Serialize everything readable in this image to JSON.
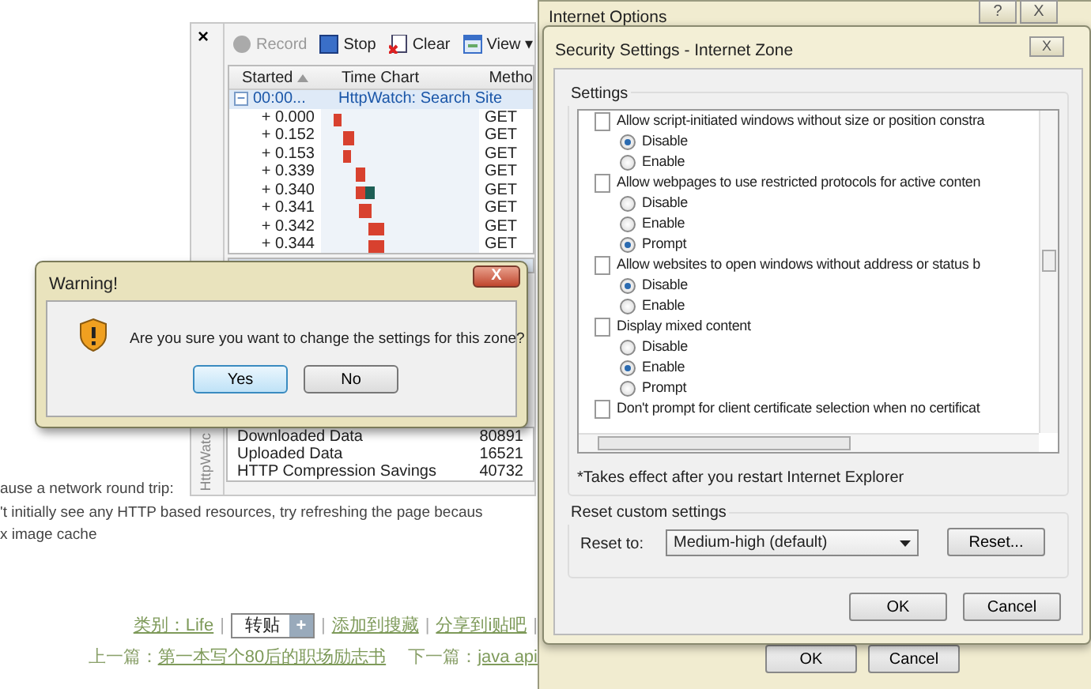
{
  "httpwatch": {
    "close": "×",
    "toolbar": [
      {
        "label": "Record",
        "disabled": true
      },
      {
        "label": "Stop",
        "disabled": false
      },
      {
        "label": "Clear",
        "disabled": false
      },
      {
        "label": "View",
        "disabled": false,
        "caret": "▾"
      }
    ],
    "columns": [
      {
        "label": "Started",
        "sorted": true
      },
      {
        "label": "Time Chart",
        "sorted": false
      },
      {
        "label": "Metho",
        "sorted": false
      }
    ],
    "group": {
      "toggle": "−",
      "started": "00:00...",
      "title": "HttpWatch: Search Site"
    },
    "requests": [
      {
        "started": "+ 0.000",
        "method": "GET"
      },
      {
        "started": "+ 0.152",
        "method": "GET"
      },
      {
        "started": "+ 0.153",
        "method": "GET"
      },
      {
        "started": "+ 0.339",
        "method": "GET"
      },
      {
        "started": "+ 0.340",
        "method": "GET"
      },
      {
        "started": "+ 0.341",
        "method": "GET"
      },
      {
        "started": "+ 0.342",
        "method": "GET"
      },
      {
        "started": "+ 0.344",
        "method": "GET"
      }
    ],
    "tab_label": "HttpWatc",
    "summary": [
      {
        "label": "Downloaded Data",
        "value": "80891"
      },
      {
        "label": "Uploaded Data",
        "value": "16521"
      },
      {
        "label": "HTTP Compression Savings",
        "value": "40732"
      }
    ]
  },
  "page": {
    "lines": [
      "ause a network round trip:",
      "'t initially see any HTTP based resources, try refreshing the page becaus",
      "x image cache"
    ],
    "footer_row": [
      {
        "kind": "link",
        "text": "类别：Life"
      },
      {
        "kind": "sep",
        "text": "|"
      },
      {
        "kind": "repost",
        "text": "转贴",
        "plus": "+"
      },
      {
        "kind": "sep",
        "text": "|"
      },
      {
        "kind": "link",
        "text": "添加到搜藏"
      },
      {
        "kind": "sep",
        "text": "|"
      },
      {
        "kind": "link",
        "text": "分享到i贴吧"
      },
      {
        "kind": "sep",
        "text": "|"
      }
    ],
    "nav": [
      {
        "label": "上一篇：",
        "link": "第一本写个80后的职场励志书"
      },
      {
        "label": "下一篇：",
        "link": "java api"
      }
    ]
  },
  "warning": {
    "title": "Warning!",
    "close": "X",
    "message": "Are you sure you want to change the settings for this zone?",
    "buttons": [
      {
        "label": "Yes",
        "focused": true
      },
      {
        "label": "No",
        "focused": false
      }
    ]
  },
  "internet_options": {
    "title": "Internet Options",
    "help": "?",
    "close": "X",
    "buttons": [
      "OK",
      "Cancel"
    ]
  },
  "security": {
    "title": "Security Settings - Internet Zone",
    "close": "X",
    "group_label": "Settings",
    "items": [
      {
        "kind": "heading",
        "text": "Allow script-initiated windows without size or position constra"
      },
      {
        "kind": "radio",
        "text": "Disable",
        "selected": true
      },
      {
        "kind": "radio",
        "text": "Enable",
        "selected": false
      },
      {
        "kind": "heading",
        "text": "Allow webpages to use restricted protocols for active conten"
      },
      {
        "kind": "radio",
        "text": "Disable",
        "selected": false
      },
      {
        "kind": "radio",
        "text": "Enable",
        "selected": false
      },
      {
        "kind": "radio",
        "text": "Prompt",
        "selected": true
      },
      {
        "kind": "heading",
        "text": "Allow websites to open windows without address or status b"
      },
      {
        "kind": "radio",
        "text": "Disable",
        "selected": true
      },
      {
        "kind": "radio",
        "text": "Enable",
        "selected": false
      },
      {
        "kind": "heading",
        "text": "Display mixed content"
      },
      {
        "kind": "radio",
        "text": "Disable",
        "selected": false
      },
      {
        "kind": "radio",
        "text": "Enable",
        "selected": true
      },
      {
        "kind": "radio",
        "text": "Prompt",
        "selected": false
      },
      {
        "kind": "heading",
        "text": "Don't prompt for client certificate selection when no certificat"
      }
    ],
    "note": "*Takes effect after you restart Internet Explorer",
    "reset_group": "Reset custom settings",
    "reset_label": "Reset to:",
    "reset_value": "Medium-high (default)",
    "reset_button": "Reset...",
    "buttons": [
      "OK",
      "Cancel"
    ]
  }
}
